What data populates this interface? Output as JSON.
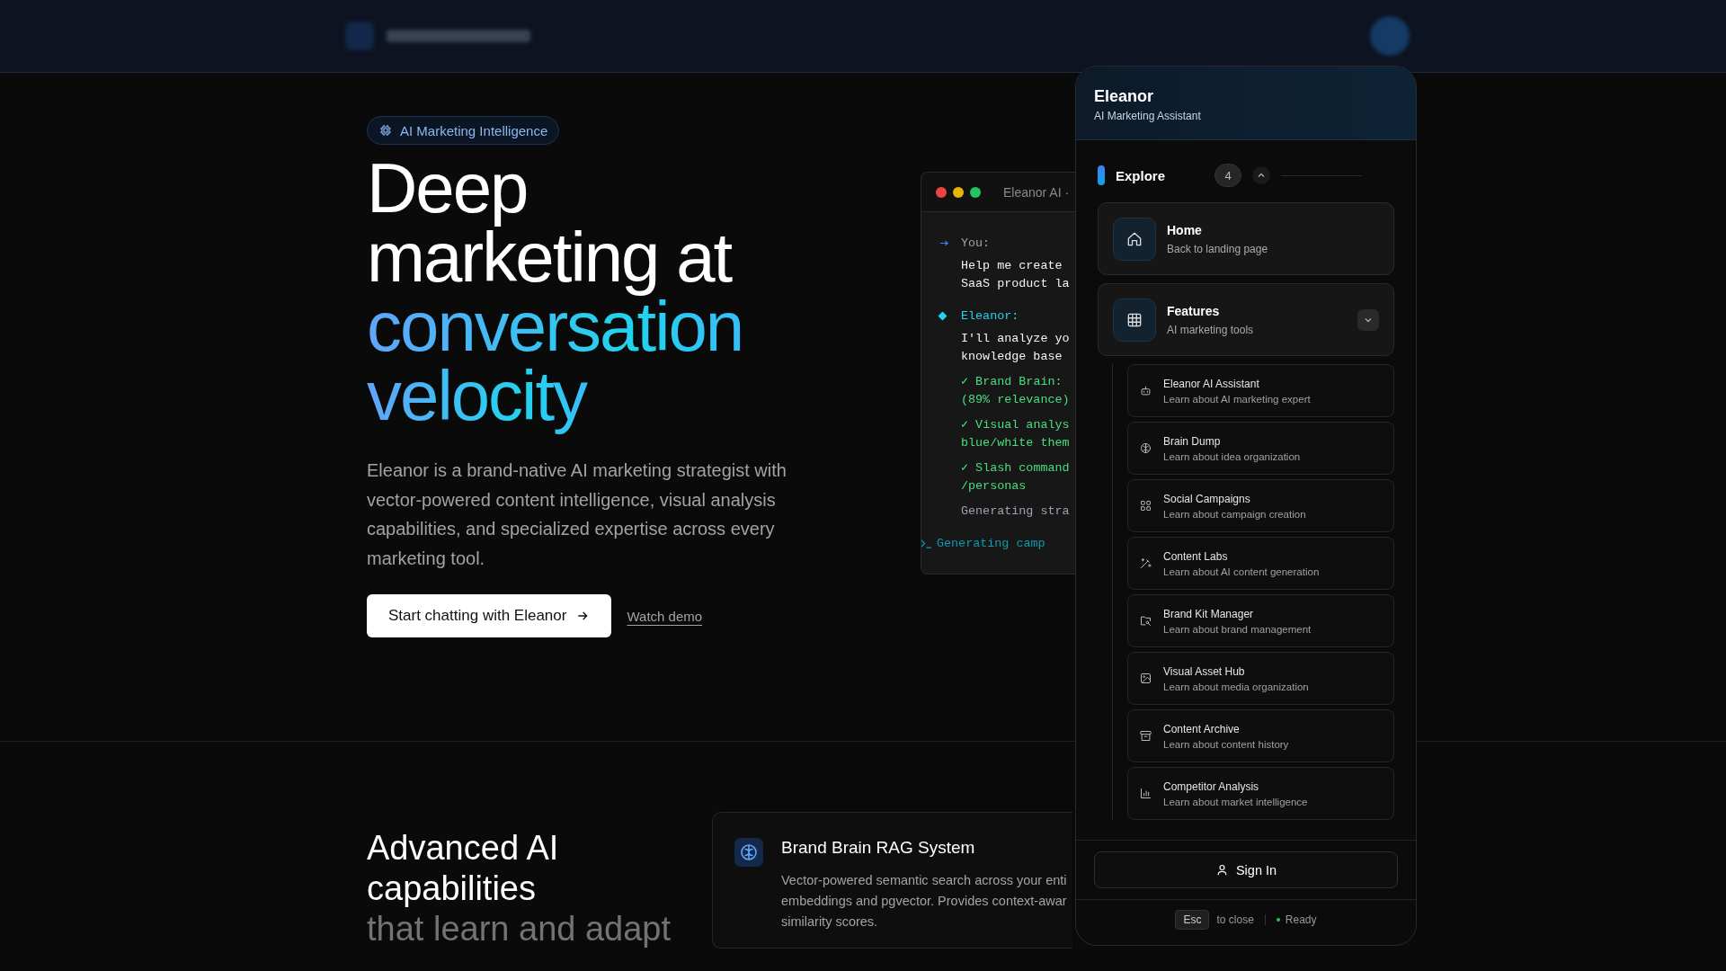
{
  "hero": {
    "badge": "AI Marketing Intelligence",
    "title_lines": [
      {
        "text": "Deep",
        "accent": false
      },
      {
        "text": "marketing at",
        "accent": false
      },
      {
        "text": "conversation",
        "accent": true
      },
      {
        "text": "velocity",
        "accent": true
      }
    ],
    "description": "Eleanor is a brand-native AI marketing strategist with vector-powered content intelligence, visual analysis capabilities, and specialized expertise across every marketing tool.",
    "primary_button": "Start chatting with Eleanor",
    "secondary_link": "Watch demo"
  },
  "terminal": {
    "title": "Eleanor AI ·",
    "lines": [
      {
        "kind": "user_label",
        "text": "You:"
      },
      {
        "kind": "text",
        "text": "Help me create"
      },
      {
        "kind": "text",
        "text": "SaaS product la"
      },
      {
        "kind": "bot_label",
        "text": "Eleanor:"
      },
      {
        "kind": "text",
        "text": "I'll analyze yo"
      },
      {
        "kind": "text",
        "text": "knowledge base"
      },
      {
        "kind": "check",
        "text": "✓ Brand Brain:"
      },
      {
        "kind": "check_cont",
        "text": "(89% relevance)"
      },
      {
        "kind": "check",
        "text": "✓ Visual analys"
      },
      {
        "kind": "check_cont",
        "text": "blue/white them"
      },
      {
        "kind": "check",
        "text": "✓ Slash command"
      },
      {
        "kind": "check_cont",
        "text": "/personas"
      },
      {
        "kind": "status",
        "text": "Generating stra"
      },
      {
        "kind": "prompt",
        "text": "Generating camp"
      }
    ]
  },
  "capabilities": {
    "title": "Advanced AI capabilities",
    "subtitle": "that learn and adapt",
    "card": {
      "title": "Brand Brain RAG System",
      "lines": [
        "Vector-powered semantic search across your enti",
        "embeddings and pgvector. Provides context-awar",
        "similarity scores."
      ]
    }
  },
  "assistant": {
    "name": "Eleanor",
    "role": "AI Marketing Assistant",
    "section": "Explore",
    "count": "4",
    "expanded": true,
    "items": [
      {
        "kind": "home",
        "title": "Home",
        "subtitle": "Back to landing page"
      },
      {
        "kind": "grid",
        "title": "Features",
        "subtitle": "AI marketing tools",
        "expanded": true,
        "children": [
          {
            "kind": "robot",
            "title": "Eleanor AI Assistant",
            "subtitle": "Learn about AI marketing expert"
          },
          {
            "kind": "brain",
            "title": "Brain Dump",
            "subtitle": "Learn about idea organization"
          },
          {
            "kind": "squares",
            "title": "Social Campaigns",
            "subtitle": "Learn about campaign creation"
          },
          {
            "kind": "wand",
            "title": "Content Labs",
            "subtitle": "Learn about AI content generation"
          },
          {
            "kind": "folder",
            "title": "Brand Kit Manager",
            "subtitle": "Learn about brand management"
          },
          {
            "kind": "image",
            "title": "Visual Asset Hub",
            "subtitle": "Learn about media organization"
          },
          {
            "kind": "archive",
            "title": "Content Archive",
            "subtitle": "Learn about content history"
          },
          {
            "kind": "chart",
            "title": "Competitor Analysis",
            "subtitle": "Learn about market intelligence"
          }
        ]
      }
    ],
    "sign_in": "Sign In",
    "esc_key": "Esc",
    "esc_hint": "to close",
    "status": "Ready"
  }
}
